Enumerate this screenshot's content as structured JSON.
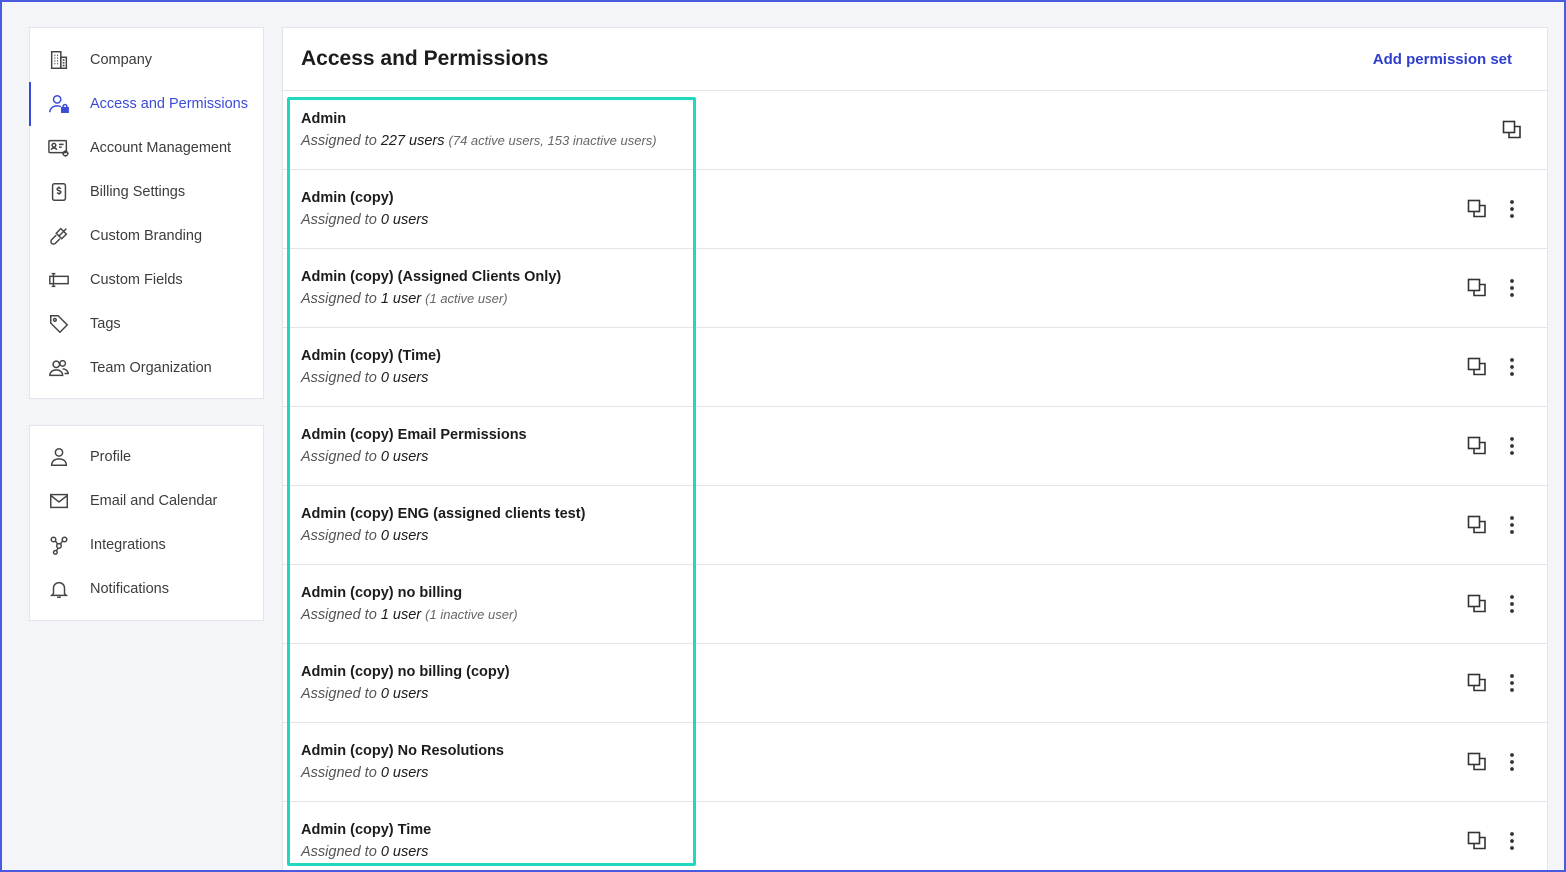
{
  "sidebar": {
    "primary": [
      {
        "id": "company",
        "label": "Company",
        "icon": "building-icon"
      },
      {
        "id": "access",
        "label": "Access and Permissions",
        "icon": "user-lock-icon",
        "active": true
      },
      {
        "id": "account",
        "label": "Account Management",
        "icon": "id-card-gear-icon"
      },
      {
        "id": "billing",
        "label": "Billing Settings",
        "icon": "dollar-doc-icon"
      },
      {
        "id": "branding",
        "label": "Custom Branding",
        "icon": "brush-icon"
      },
      {
        "id": "fields",
        "label": "Custom Fields",
        "icon": "text-field-icon"
      },
      {
        "id": "tags",
        "label": "Tags",
        "icon": "tag-icon"
      },
      {
        "id": "team",
        "label": "Team Organization",
        "icon": "users-icon"
      }
    ],
    "secondary": [
      {
        "id": "profile",
        "label": "Profile",
        "icon": "person-icon"
      },
      {
        "id": "email",
        "label": "Email and Calendar",
        "icon": "envelope-icon"
      },
      {
        "id": "integrations",
        "label": "Integrations",
        "icon": "network-icon"
      },
      {
        "id": "notifications",
        "label": "Notifications",
        "icon": "bell-icon"
      }
    ]
  },
  "main": {
    "title": "Access and Permissions",
    "add_label": "Add permission set",
    "assigned_prefix": "Assigned to",
    "rows": [
      {
        "name": "Admin",
        "count": "227 users",
        "detail": "(74 active users, 153 inactive users)",
        "menu": false
      },
      {
        "name": "Admin (copy)",
        "count": "0 users",
        "detail": "",
        "menu": true
      },
      {
        "name": "Admin (copy) (Assigned Clients Only)",
        "count": "1 user",
        "detail": "(1 active user)",
        "menu": true
      },
      {
        "name": "Admin (copy) (Time)",
        "count": "0 users",
        "detail": "",
        "menu": true
      },
      {
        "name": "Admin (copy) Email Permissions",
        "count": "0 users",
        "detail": "",
        "menu": true
      },
      {
        "name": "Admin (copy) ENG (assigned clients test)",
        "count": "0 users",
        "detail": "",
        "menu": true
      },
      {
        "name": "Admin (copy) no billing",
        "count": "1 user",
        "detail": "(1 inactive user)",
        "menu": true
      },
      {
        "name": "Admin (copy) no billing (copy)",
        "count": "0 users",
        "detail": "",
        "menu": true
      },
      {
        "name": "Admin (copy) No Resolutions",
        "count": "0 users",
        "detail": "",
        "menu": true
      },
      {
        "name": "Admin (copy) Time",
        "count": "0 users",
        "detail": "",
        "menu": true
      }
    ]
  },
  "colors": {
    "accent": "#3a4bd8",
    "highlight": "#1fd8bd"
  }
}
